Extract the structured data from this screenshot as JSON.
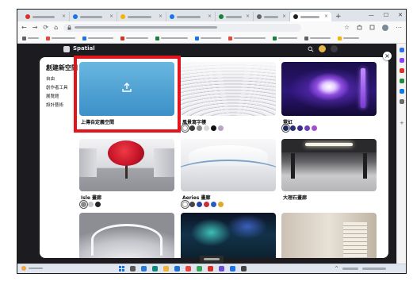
{
  "browser": {
    "tabs": [
      "#d93025",
      "#1a73e8",
      "#f4b400",
      "#1a73e8",
      "#188038",
      "#5f6368",
      "#1f1f1f"
    ],
    "tab_close": "×",
    "new_tab": "+",
    "window_controls": {
      "minimize": "—",
      "maximize": "☐",
      "close": "✕"
    },
    "address": {
      "back": "←",
      "forward": "→",
      "refresh": "⟳",
      "home": "⌂",
      "favorite": "☆",
      "more": "⋯"
    },
    "bookmarks": [
      "#5f6368",
      "#e8453c",
      "#1a73e8",
      "#d93025",
      "#188038",
      "#1a73e8",
      "#e8453c",
      "#188038",
      "#5f6368",
      "#f4b400"
    ]
  },
  "spatial_nav": {
    "brand": "Spatial"
  },
  "modal": {
    "title": "創建新空間",
    "close_label": "×",
    "categories": [
      "自由",
      "創作者工具",
      "展覽館",
      "設計藝術"
    ],
    "tiles": [
      {
        "label": "上傳自定義空間",
        "swatches": []
      },
      {
        "label": "風景寫字樓",
        "swatches": [
          "#ffffff",
          "#3a3a3a",
          "#8c8c8c",
          "#d8d8d8",
          "#111111",
          "#b9a3c6"
        ]
      },
      {
        "label": "霓虹",
        "swatches": [
          "#1f2a5c",
          "#2b2f7a",
          "#3b2a86",
          "#6b3fb5",
          "#a44fc8"
        ]
      },
      {
        "label": "Isle 畫廊",
        "swatches": [
          "#8a8a8a",
          "#c7c7c7",
          "#222222"
        ]
      },
      {
        "label": "Aeries 畫廊",
        "swatches": [
          "#ffffff",
          "#444444",
          "#2346a8",
          "#c8313a",
          "#2b5cc4",
          "#e0a92a"
        ]
      },
      {
        "label": "大理石畫廊",
        "swatches": []
      }
    ],
    "highlight_color": "#e3141b"
  },
  "sidebar": {
    "icons": [
      "#2f6fe4",
      "#8a3ffc",
      "#d9342b",
      "#1e8c3a",
      "#0f7bdc",
      "#6b6b6b"
    ],
    "add": "+"
  },
  "taskbar": {
    "apps": [
      "#5a5a5a",
      "#2b7bd6",
      "#0f8a7a",
      "#f2b233",
      "#1d6fd0",
      "#e8453c",
      "#34a853",
      "#d93025",
      "#6d4fd1",
      "#1a73e8",
      "#444444"
    ],
    "tray_up": "^"
  }
}
